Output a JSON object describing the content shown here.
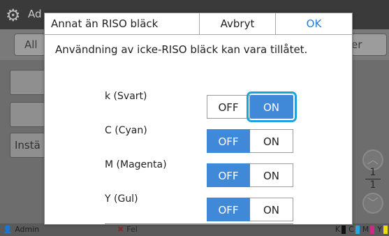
{
  "background": {
    "header_title": "Ad",
    "tabs": [
      {
        "label": "All"
      },
      {
        "label": "er"
      }
    ],
    "side_button": "Instä",
    "page_indicator": {
      "current": "1",
      "total": "1"
    },
    "footer": {
      "user": "Admin",
      "error": "Fel",
      "inks": [
        {
          "letter": "K",
          "color": "#111111"
        },
        {
          "letter": "C",
          "color": "#24a8e0"
        },
        {
          "letter": "M",
          "color": "#d0288a"
        },
        {
          "letter": "Y",
          "color": "#f0e000"
        }
      ]
    }
  },
  "dialog": {
    "title": "Annat än RISO bläck",
    "cancel_label": "Avbryt",
    "ok_label": "OK",
    "description": "Användning av icke-RISO bläck kan vara tillåtet.",
    "off_label": "OFF",
    "on_label": "ON",
    "rows": [
      {
        "label": "k (Svart)",
        "selected": "ON"
      },
      {
        "label": "C (Cyan)",
        "selected": "OFF"
      },
      {
        "label": "M (Magenta)",
        "selected": "OFF"
      },
      {
        "label": "Y (Gul)",
        "selected": "OFF"
      }
    ]
  },
  "colors": {
    "accent": "#3f89d8",
    "focus_ring": "#1aa3e0",
    "ok_text": "#2a7ad0"
  }
}
